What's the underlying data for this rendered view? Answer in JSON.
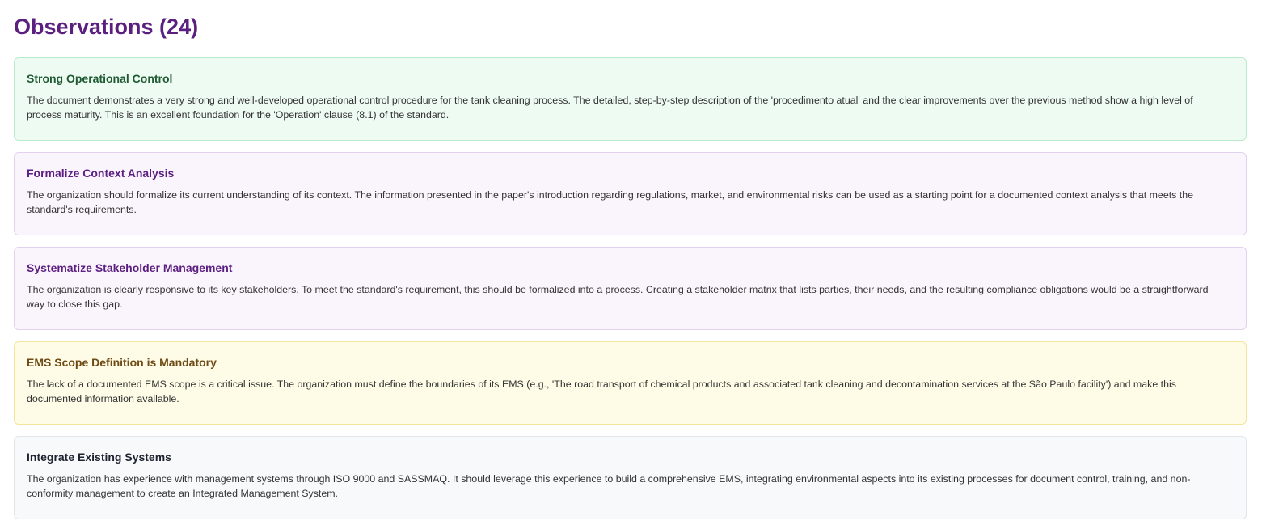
{
  "header": {
    "title": "Observations (24)"
  },
  "observations": [
    {
      "title": "Strong Operational Control",
      "text": "The document demonstrates a very strong and well-developed operational control procedure for the tank cleaning process. The detailed, step-by-step description of the 'procedimento atual' and the clear improvements over the previous method show a high level of process maturity. This is an excellent foundation for the 'Operation' clause (8.1) of the standard.",
      "variant": "green",
      "color": "#1f5a33"
    },
    {
      "title": "Formalize Context Analysis",
      "text": "The organization should formalize its current understanding of its context. The information presented in the paper's introduction regarding regulations, market, and environmental risks can be used as a starting point for a documented context analysis that meets the standard's requirements.",
      "variant": "purple",
      "color": "#5b1f80"
    },
    {
      "title": "Systematize Stakeholder Management",
      "text": "The organization is clearly responsive to its key stakeholders. To meet the standard's requirement, this should be formalized into a process. Creating a stakeholder matrix that lists parties, their needs, and the resulting compliance obligations would be a straightforward way to close this gap.",
      "variant": "purple",
      "color": "#5b1f80"
    },
    {
      "title": "EMS Scope Definition is Mandatory",
      "text": "The lack of a documented EMS scope is a critical issue. The organization must define the boundaries of its EMS (e.g., 'The road transport of chemical products and associated tank cleaning and decontamination services at the São Paulo facility') and make this documented information available.",
      "variant": "yellow",
      "color": "#6e4a14"
    },
    {
      "title": "Integrate Existing Systems",
      "text": "The organization has experience with management systems through ISO 9000 and SASSMAQ. It should leverage this experience to build a comprehensive EMS, integrating environmental aspects into its existing processes for document control, training, and non-conformity management to create an Integrated Management System.",
      "variant": "gray",
      "color": "#1e2330"
    }
  ]
}
